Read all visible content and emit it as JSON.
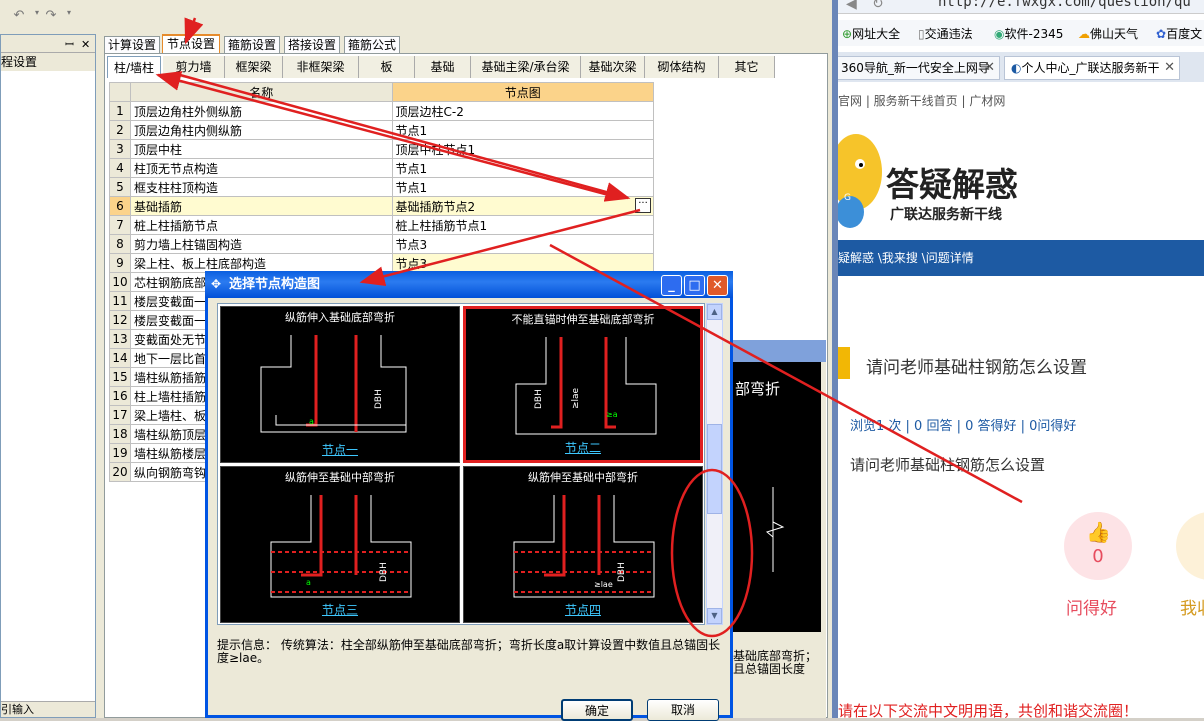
{
  "left_app": {
    "side_panel": {
      "head": "程设置",
      "title": "程设置",
      "footer": "引输入"
    },
    "top_tabs": [
      "计算设置",
      "节点设置",
      "箍筋设置",
      "搭接设置",
      "箍筋公式"
    ],
    "sub_tabs": [
      "柱/墙柱",
      "剪力墙",
      "框架梁",
      "非框架梁",
      "板",
      "基础",
      "基础主梁/承台梁",
      "基础次梁",
      "砌体结构",
      "其它"
    ],
    "grid": {
      "headers": [
        "名称",
        "节点图"
      ],
      "rows": [
        {
          "n": "1",
          "name": "顶层边角柱外侧纵筋",
          "value": "顶层边柱C-2"
        },
        {
          "n": "2",
          "name": "顶层边角柱内侧纵筋",
          "value": "节点1"
        },
        {
          "n": "3",
          "name": "顶层中柱",
          "value": "顶层中柱节点1"
        },
        {
          "n": "4",
          "name": "柱顶无节点构造",
          "value": "节点1"
        },
        {
          "n": "5",
          "name": "框支柱柱顶构造",
          "value": "节点1"
        },
        {
          "n": "6",
          "name": "基础插筋",
          "value": "基础插筋节点2"
        },
        {
          "n": "7",
          "name": "桩上柱插筋节点",
          "value": "桩上柱插筋节点1"
        },
        {
          "n": "8",
          "name": "剪力墙上柱锚固构造",
          "value": "节点3"
        },
        {
          "n": "9",
          "name": "梁上柱、板上柱底部构造",
          "value": "节点3"
        },
        {
          "n": "10",
          "name": "芯柱钢筋底部",
          "value": ""
        },
        {
          "n": "11",
          "name": "楼层变截面一",
          "value": ""
        },
        {
          "n": "12",
          "name": "楼层变截面一",
          "value": ""
        },
        {
          "n": "13",
          "name": "变截面处无节",
          "value": ""
        },
        {
          "n": "14",
          "name": "地下一层比首",
          "value": ""
        },
        {
          "n": "15",
          "name": "墙柱纵筋插筋",
          "value": ""
        },
        {
          "n": "16",
          "name": "柱上墙柱插筋",
          "value": ""
        },
        {
          "n": "17",
          "name": "梁上墙柱、板",
          "value": ""
        },
        {
          "n": "18",
          "name": "墙柱纵筋顶层",
          "value": ""
        },
        {
          "n": "19",
          "name": "墙柱纵筋楼层",
          "value": ""
        },
        {
          "n": "20",
          "name": "纵向钢筋弯钩",
          "value": ""
        }
      ]
    },
    "ellipsis_button": "···",
    "bg_dialog": {
      "big_text": "部弯折",
      "hint": "基础底部弯折；且总锚固长度"
    }
  },
  "dialog": {
    "title": "选择节点构造图",
    "nodes": [
      {
        "caption": "纵筋伸入基础底部弯折",
        "name": "节点一"
      },
      {
        "caption": "不能直锚时伸至基础底部弯折",
        "name": "节点二"
      },
      {
        "caption": "纵筋伸至基础中部弯折",
        "name": "节点三"
      },
      {
        "caption": "纵筋伸至基础中部弯折",
        "name": "节点四"
      }
    ],
    "hint": "提示信息： 传统算法：柱全部纵筋伸至基础底部弯折；弯折长度a取计算设置中数值且总锚固长度≥lae。",
    "ok": "确定",
    "cancel": "取消"
  },
  "browser": {
    "url": "http://e.fwxgx.com/question/qu",
    "bookmarks": [
      "网址大全",
      "交通违法",
      "软件-2345",
      "佛山天气",
      "百度文"
    ],
    "tabs": [
      "360导航_新一代安全上网导",
      "个人中心_广联达服务新干"
    ],
    "site_links": "官网  |  服务新干线首页  |  广材网",
    "logo_title": "答疑解惑",
    "logo_sub": "广联达服务新干线",
    "breadcrumb": "疑解惑 \\我来搜 \\问题详情",
    "question_title": "请问老师基础柱钢筋怎么设置",
    "stats": "浏览1 次 | 0 回答 | 0 答得好 | 0问得好",
    "question_body": "请问老师基础柱钢筋怎么设置",
    "good_count": "0",
    "good_label": "问得好",
    "fav_label": "我收",
    "footer_note": "请在以下交流中文明用语，共创和谐交流圈！"
  },
  "colors": {
    "annotation": "#e02020",
    "titlebar": "#0a5fe0",
    "selected_row": "#fffbd0"
  }
}
